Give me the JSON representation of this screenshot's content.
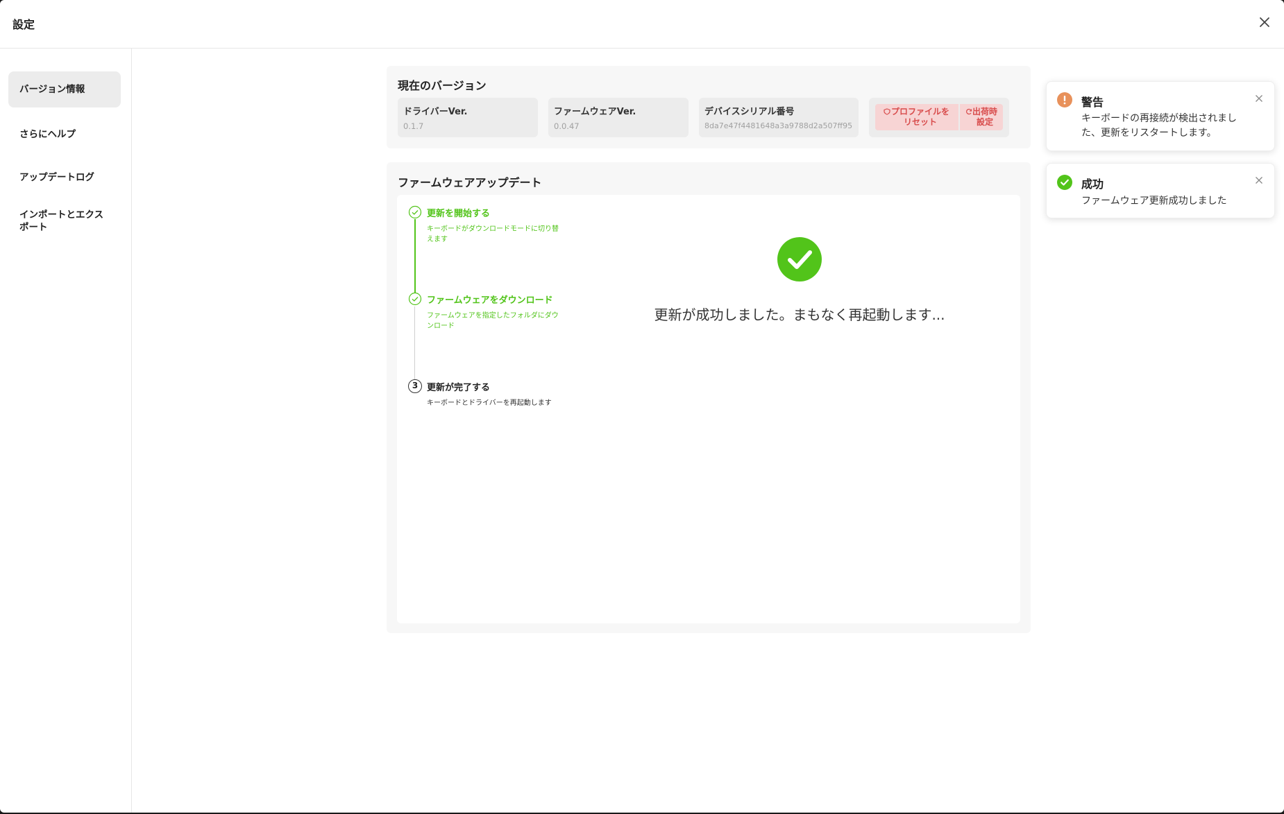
{
  "window": {
    "title": "設定"
  },
  "sidebar": {
    "items": [
      {
        "label": "バージョン情報",
        "active": true
      },
      {
        "label": "さらにヘルプ",
        "active": false
      },
      {
        "label": "アップデートログ",
        "active": false
      },
      {
        "label": "インポートとエクスポート",
        "active": false
      }
    ]
  },
  "version_panel": {
    "title": "現在のバージョン",
    "driver": {
      "label": "ドライバーVer.",
      "value": "0.1.7"
    },
    "firmware": {
      "label": "ファームウェアVer.",
      "value": "0.0.47"
    },
    "serial": {
      "label": "デバイスシリアル番号",
      "value": "8da7e47f4481648a3a9788d2a507ff95"
    },
    "reset_profile_label": "プロファイルをリセット",
    "factory_reset_label": "出荷時設定"
  },
  "update_panel": {
    "title": "ファームウェアアップデート",
    "steps": [
      {
        "title": "更新を開始する",
        "desc": "キーボードがダウンロードモードに切り替えます",
        "status": "done"
      },
      {
        "title": "ファームウェアをダウンロード",
        "desc": "ファームウェアを指定したフォルダにダウンロード",
        "status": "done"
      },
      {
        "title": "更新が完了する",
        "desc": "キーボードとドライバーを再起動します",
        "status": "pending",
        "number": "3"
      }
    ],
    "result_message": "更新が成功しました。まもなく再起動します..."
  },
  "toasts": [
    {
      "type": "warning",
      "title": "警告",
      "message": "キーボードの再接続が検出されました、更新をリスタートします。",
      "icon": "exclamation-icon"
    },
    {
      "type": "success",
      "title": "成功",
      "message": "ファームウェア更新成功しました",
      "icon": "check-circle-icon"
    }
  ],
  "colors": {
    "success": "#52c41a",
    "warning": "#e8915b",
    "danger": "#d84c4c"
  }
}
